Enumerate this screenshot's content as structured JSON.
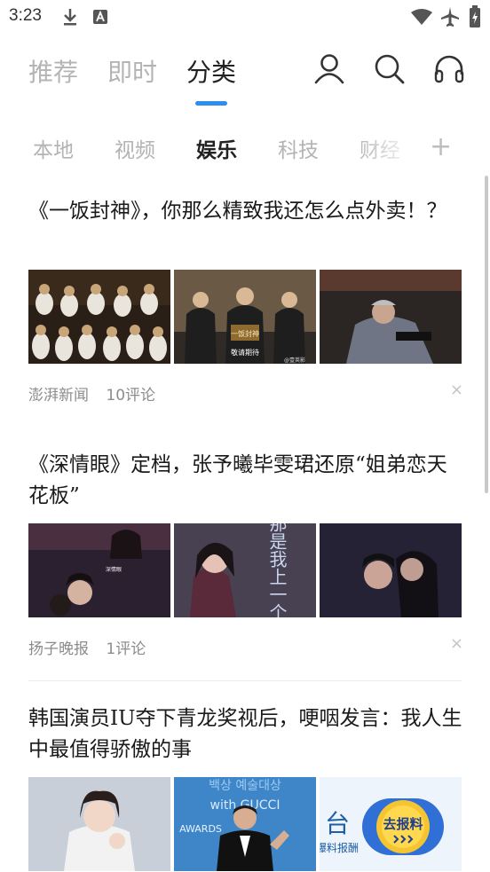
{
  "status_bar": {
    "time": "3:23"
  },
  "top_tabs": [
    {
      "label": "推荐"
    },
    {
      "label": "即时"
    },
    {
      "label": "分类"
    }
  ],
  "categories": [
    {
      "label": "本地"
    },
    {
      "label": "视频"
    },
    {
      "label": "娱乐"
    },
    {
      "label": "科技"
    },
    {
      "label": "财经"
    }
  ],
  "add_category": "+",
  "articles": [
    {
      "title": "《一饭封神》，你那么精致我还怎么点外卖！？",
      "source": "澎湃新闻",
      "comments": "10评论",
      "thumb_texts": [
        "一饭封神",
        "敬请期待",
        "@壹英影"
      ]
    },
    {
      "title": "《深情眼》定档，张予曦毕雯珺还原“姐弟恋天花板”",
      "source": "扬子晚报",
      "comments": "1评论",
      "thumb_texts": [
        "深情眼",
        "那是我上一个人"
      ]
    },
    {
      "title": "韩国演员IU夺下青龙奖视后，哽咽发言：我人生中最值得骄傲的事",
      "thumb_texts": [
        "백상 예술대상",
        "with GUCCI",
        "AWARDS",
        "台",
        "爆料报酬"
      ]
    }
  ],
  "float_badge": {
    "label": "去报料"
  },
  "close_symbol": "×"
}
